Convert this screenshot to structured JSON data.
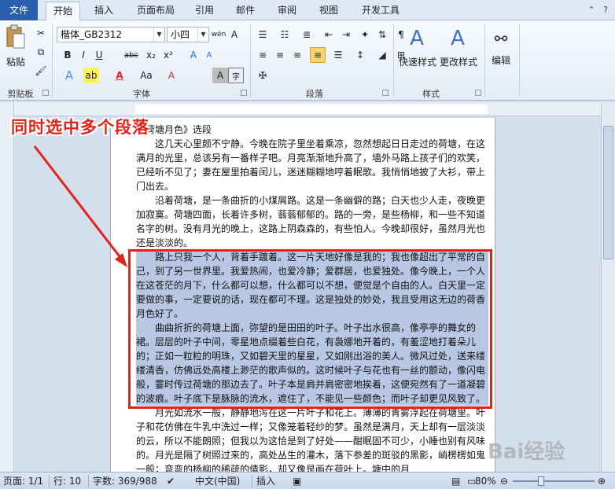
{
  "tabs": {
    "file": "文件",
    "home": "开始",
    "insert": "插入",
    "layout": "页面布局",
    "references": "引用",
    "mailings": "邮件",
    "review": "审阅",
    "view": "视图",
    "developer": "开发工具"
  },
  "ribbon": {
    "clipboard": {
      "paste": "粘贴",
      "label": "剪贴板"
    },
    "font": {
      "font_name": "楷体_GB2312",
      "font_size": "小四",
      "label": "字体",
      "bold": "B",
      "italic": "I",
      "underline": "U",
      "strike": "abc",
      "sub": "x₂",
      "sup": "x²",
      "change_case": "Aa",
      "grow": "A",
      "shrink": "A",
      "clear": "A",
      "phonetic": "wén",
      "char_border": "A",
      "char_shade": "A"
    },
    "paragraph": {
      "label": "段落"
    },
    "styles": {
      "quick": "快速样式",
      "change": "更改样式",
      "label": "样式"
    },
    "editing": {
      "label": "编辑"
    }
  },
  "annotation": {
    "text": "同时选中多个段落"
  },
  "document": {
    "paragraphs": [
      {
        "text": "《荷塘月色》选段",
        "selected": false,
        "indent": false
      },
      {
        "text": "这几天心里颇不宁静。今晚在院子里坐着乘凉，忽然想起日日走过的荷塘，在这满月的光里，总该另有一番样子吧。月亮渐渐地升高了，墙外马路上孩子们的欢笑，已经听不见了；妻在屋里拍着闰儿，迷迷糊糊地哼着眠歌。我悄悄地披了大衫，带上门出去。",
        "selected": false,
        "indent": true
      },
      {
        "text": "沿着荷塘，是一条曲折的小煤屑路。这是一条幽僻的路；白天也少人走，夜晚更加寂寞。荷塘四面，长着许多树，蓊蓊郁郁的。路的一旁，是些杨柳，和一些不知道名字的树。没有月光的晚上，这路上阴森森的，有些怕人。今晚却很好，虽然月光也还是淡淡的。",
        "selected": false,
        "indent": true
      },
      {
        "text": "路上只我一个人，背着手踱着。这一片天地好像是我的；我也像超出了平常的自己，到了另一世界里。我爱热闹，也爱冷静；爱群居，也爱独处。像今晚上，一个人在这苍茫的月下，什么都可以想，什么都可以不想，便觉是个自由的人。白天里一定要做的事，一定要说的话，现在都可不理。这是独处的妙处，我且受用这无边的荷香月色好了。",
        "selected": true,
        "indent": true
      },
      {
        "text": "曲曲折折的荷塘上面，弥望的是田田的叶子。叶子出水很高，像亭亭的舞女的裙。层层的叶子中间，零星地点缀着些白花，有袅娜地开着的，有羞涩地打着朵儿的；正如一粒粒的明珠，又如碧天里的星星，又如刚出浴的美人。微风过处，送来缕缕清香，仿佛远处高楼上渺茫的歌声似的。这时候叶子与花也有一丝的颤动，像闪电般，霎时传过荷塘的那边去了。叶子本是肩并肩密密地挨着，这便宛然有了一道凝碧的波痕。叶子底下是脉脉的流水，遮住了，不能见一些颜色；而叶子却更见风致了。",
        "selected": true,
        "indent": true
      },
      {
        "text": "月光如流水一般，静静地泻在这一片叶子和花上。薄薄的青雾浮起在荷塘里。叶子和花仿佛在牛乳中洗过一样；又像笼着轻纱的梦。虽然是满月，天上却有一层淡淡的云，所以不能朗照；但我以为这恰是到了好处——酣眠固不可少，小睡也别有风味的。月光是隔了树照过来的，高处丛生的灌木，落下参差的斑驳的黑影，峭楞楞如鬼一般；弯弯的杨柳的稀疏的倩影，却又像是画在荷叶上。塘中的月",
        "selected": false,
        "indent": true
      }
    ]
  },
  "status": {
    "page": "页面: 1/1",
    "line": "行: 10",
    "words": "字数: 369/988",
    "language": "中文(中国)",
    "mode": "插入",
    "zoom": "80%"
  },
  "watermark": "Bai经验"
}
